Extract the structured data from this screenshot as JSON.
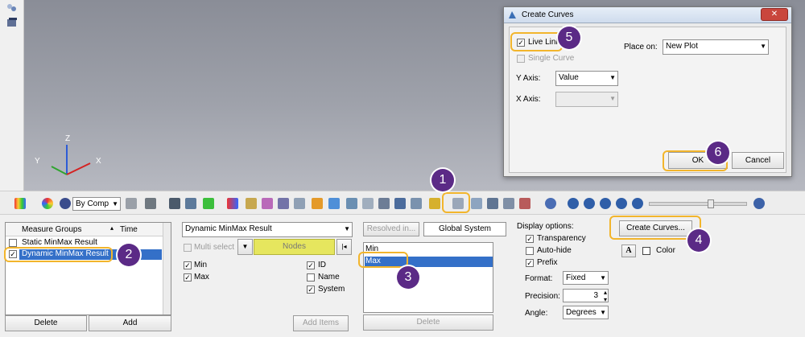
{
  "dialog": {
    "title": "Create Curves",
    "live_link_label": "Live Link",
    "single_curve_label": "Single Curve",
    "place_on_label": "Place on:",
    "place_on_value": "New Plot",
    "y_axis_label": "Y Axis:",
    "y_axis_value": "Value",
    "x_axis_label": "X Axis:",
    "x_axis_value": "",
    "ok_label": "OK",
    "cancel_label": "Cancel",
    "close_glyph": "✕"
  },
  "viewport": {
    "axis_z": "Z",
    "axis_y": "Y",
    "axis_x": "X"
  },
  "toolbar": {
    "comp_label": "By Comp"
  },
  "measure_groups": {
    "col_groups": "Measure Groups",
    "col_time": "Time",
    "rows": [
      "Static MinMax Result",
      "Dynamic MinMax Result"
    ],
    "delete_label": "Delete",
    "add_label": "Add"
  },
  "result": {
    "type_value": "Dynamic MinMax Result",
    "multi_select_label": "Multi select",
    "nodes_label": "Nodes",
    "min_label": "Min",
    "max_label": "Max",
    "id_label": "ID",
    "name_label": "Name",
    "system_label": "System",
    "add_items_label": "Add Items"
  },
  "system": {
    "resolved_label": "Resolved in...",
    "global_label": "Global System",
    "list": [
      "Min",
      "Max"
    ],
    "delete_label": "Delete"
  },
  "display": {
    "title": "Display options:",
    "transparency_label": "Transparency",
    "auto_hide_label": "Auto-hide",
    "prefix_label": "Prefix",
    "format_label": "Format:",
    "format_value": "Fixed",
    "precision_label": "Precision:",
    "precision_value": "3",
    "angle_label": "Angle:",
    "angle_value": "Degrees"
  },
  "create": {
    "create_curves_label": "Create Curves...",
    "color_label": "Color",
    "font_glyph": "A"
  },
  "callouts": [
    "1",
    "2",
    "3",
    "4",
    "5",
    "6"
  ],
  "glyphs": {
    "check": "✓",
    "dropdown": "▼",
    "first": "|◂",
    "up": "▴",
    "down": "▾"
  }
}
